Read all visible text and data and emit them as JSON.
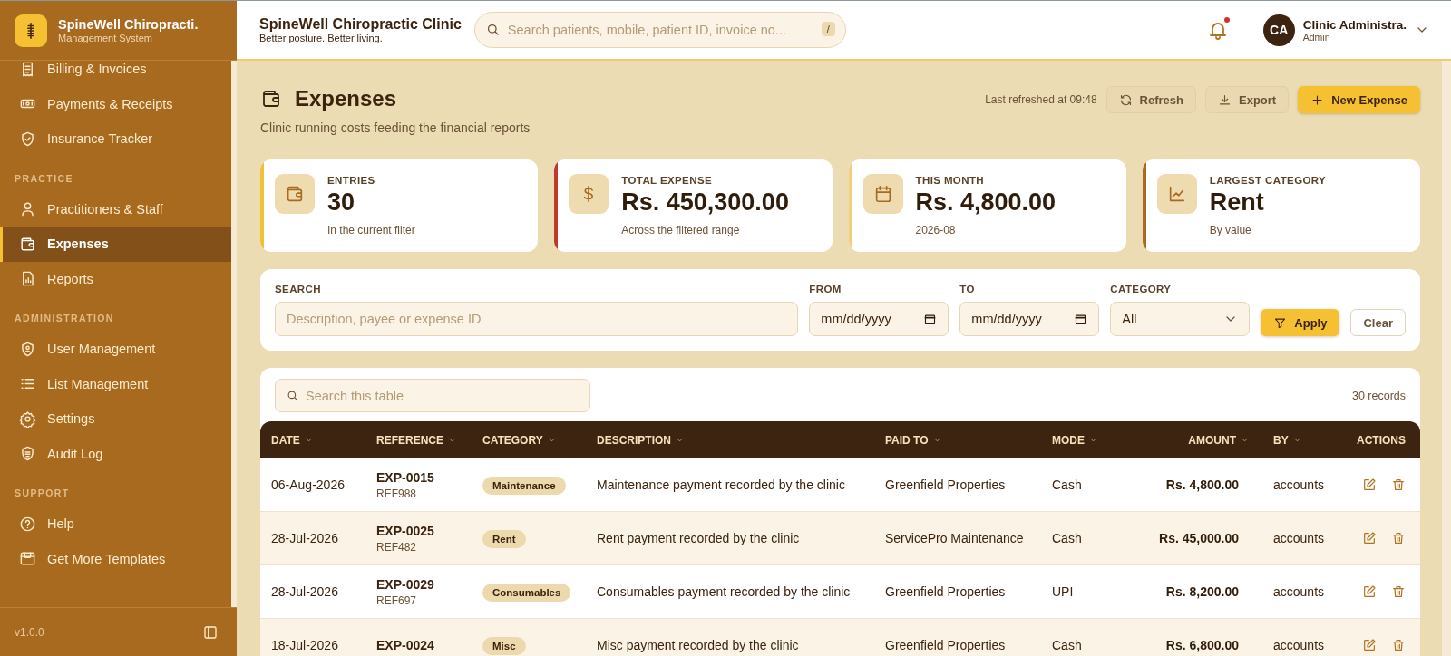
{
  "brand": {
    "name": "SpineWell Chiropracti.",
    "subtitle": "Management System"
  },
  "sidebar": {
    "sections": [
      {
        "items": [
          {
            "label": "Billing & Invoices",
            "selected": false
          },
          {
            "label": "Payments & Receipts",
            "selected": false
          },
          {
            "label": "Insurance Tracker",
            "selected": false
          }
        ]
      },
      {
        "heading": "PRACTICE",
        "items": [
          {
            "label": "Practitioners & Staff",
            "selected": false
          },
          {
            "label": "Expenses",
            "selected": true
          },
          {
            "label": "Reports",
            "selected": false
          }
        ]
      },
      {
        "heading": "ADMINISTRATION",
        "items": [
          {
            "label": "User Management",
            "selected": false
          },
          {
            "label": "List Management",
            "selected": false
          },
          {
            "label": "Settings",
            "selected": false
          },
          {
            "label": "Audit Log",
            "selected": false
          }
        ]
      },
      {
        "heading": "SUPPORT",
        "items": [
          {
            "label": "Help",
            "selected": false
          },
          {
            "label": "Get More Templates",
            "selected": false
          }
        ]
      }
    ],
    "version": "v1.0.0"
  },
  "header": {
    "clinic_name": "SpineWell Chiropractic Clinic",
    "tagline": "Better posture. Better living.",
    "search": {
      "placeholder": "Search patients, mobile, patient ID, invoice no...",
      "shortcut": "/"
    },
    "notification": {
      "unread": true
    },
    "user": {
      "initials": "CA",
      "name": "Clinic Administra.",
      "role": "Admin"
    }
  },
  "page": {
    "title": "Expenses",
    "subtitle": "Clinic running costs feeding the financial reports",
    "last_refreshed": "Last refreshed at 09:48",
    "actions": [
      {
        "label": "Refresh",
        "kind": "secondary"
      },
      {
        "label": "Export",
        "kind": "secondary"
      },
      {
        "label": "New Expense",
        "kind": "primary"
      }
    ]
  },
  "stats": [
    {
      "label": "ENTRIES",
      "value": "30",
      "note": "In the current filter",
      "color": "#f2c036"
    },
    {
      "label": "TOTAL EXPENSE",
      "value": "Rs. 450,300.00",
      "note": "Across the filtered range",
      "color": "#c0392b"
    },
    {
      "label": "THIS MONTH",
      "value": "Rs. 4,800.00",
      "note": "2026-08",
      "color": "#f3cf7a"
    },
    {
      "label": "LARGEST CATEGORY",
      "value": "Rent",
      "note": "By value",
      "color": "#a86a1e"
    }
  ],
  "filters": {
    "fields": [
      {
        "kind": "text",
        "label": "SEARCH",
        "placeholder": "Description, payee or expense ID"
      },
      {
        "kind": "date",
        "label": "FROM",
        "value": "mm/dd/yyyy"
      },
      {
        "kind": "date",
        "label": "TO",
        "value": "mm/dd/yyyy"
      },
      {
        "kind": "select",
        "label": "CATEGORY",
        "value": "All"
      }
    ],
    "buttons": [
      {
        "label": "Apply",
        "kind": "primary"
      },
      {
        "label": "Clear",
        "kind": "secondary"
      }
    ]
  },
  "table": {
    "search_placeholder": "Search this table",
    "record_count": "30 records",
    "columns": [
      {
        "label": "DATE",
        "sortable": true
      },
      {
        "label": "REFERENCE",
        "sortable": true
      },
      {
        "label": "CATEGORY",
        "sortable": true
      },
      {
        "label": "DESCRIPTION",
        "sortable": true
      },
      {
        "label": "PAID TO",
        "sortable": true
      },
      {
        "label": "MODE",
        "sortable": true
      },
      {
        "label": "AMOUNT",
        "sortable": true
      },
      {
        "label": "BY",
        "sortable": true
      },
      {
        "label": "ACTIONS",
        "sortable": false
      }
    ],
    "rows": [
      {
        "date": "06-Aug-2026",
        "reference": "EXP-0015",
        "ref_code": "REF988",
        "category": "Maintenance",
        "description": "Maintenance payment recorded by the clinic",
        "paid_to": "Greenfield Properties",
        "mode": "Cash",
        "amount": "Rs. 4,800.00",
        "by": "accounts"
      },
      {
        "date": "28-Jul-2026",
        "reference": "EXP-0025",
        "ref_code": "REF482",
        "category": "Rent",
        "description": "Rent payment recorded by the clinic",
        "paid_to": "ServicePro Maintenance",
        "mode": "Cash",
        "amount": "Rs. 45,000.00",
        "by": "accounts"
      },
      {
        "date": "28-Jul-2026",
        "reference": "EXP-0029",
        "ref_code": "REF697",
        "category": "Consumables",
        "description": "Consumables payment recorded by the clinic",
        "paid_to": "Greenfield Properties",
        "mode": "UPI",
        "amount": "Rs. 8,200.00",
        "by": "accounts"
      },
      {
        "date": "18-Jul-2026",
        "reference": "EXP-0024",
        "category": "Misc",
        "description": "Misc payment recorded by the clinic",
        "paid_to": "Greenfield Properties",
        "mode": "Cash",
        "amount": "Rs. 6,800.00",
        "by": "accounts"
      }
    ]
  }
}
